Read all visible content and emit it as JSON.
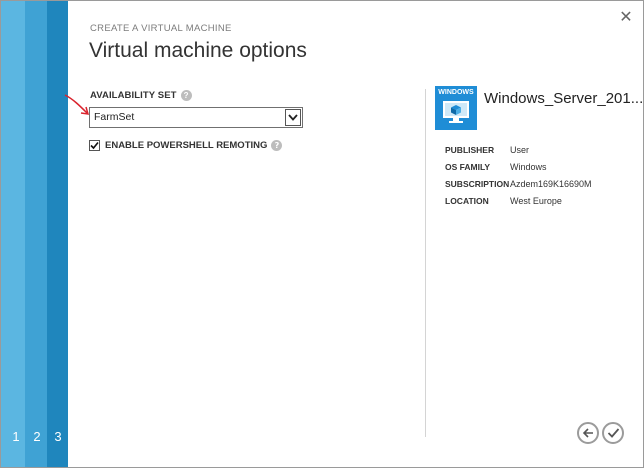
{
  "steps": [
    "1",
    "2",
    "3"
  ],
  "header": {
    "wizard_title": "CREATE A VIRTUAL MACHINE",
    "page_title": "Virtual machine options"
  },
  "form": {
    "availability_set_label": "AVAILABILITY SET",
    "availability_set_value": "FarmSet",
    "powershell_label": "ENABLE POWERSHELL REMOTING",
    "powershell_checked": true
  },
  "image": {
    "tile_label": "WINDOWS",
    "name": "Windows_Server_201...",
    "details": [
      {
        "key": "PUBLISHER",
        "value": "User"
      },
      {
        "key": "OS FAMILY",
        "value": "Windows"
      },
      {
        "key": "SUBSCRIPTION",
        "value": "Azdem169K16690M"
      },
      {
        "key": "LOCATION",
        "value": "West Europe"
      }
    ]
  },
  "colors": {
    "accent": "#1f86bd",
    "tile": "#1f8dd6",
    "arrow": "#d9232d"
  },
  "icons": {
    "close": "close-icon",
    "back": "back-arrow-icon",
    "finish": "checkmark-icon"
  }
}
